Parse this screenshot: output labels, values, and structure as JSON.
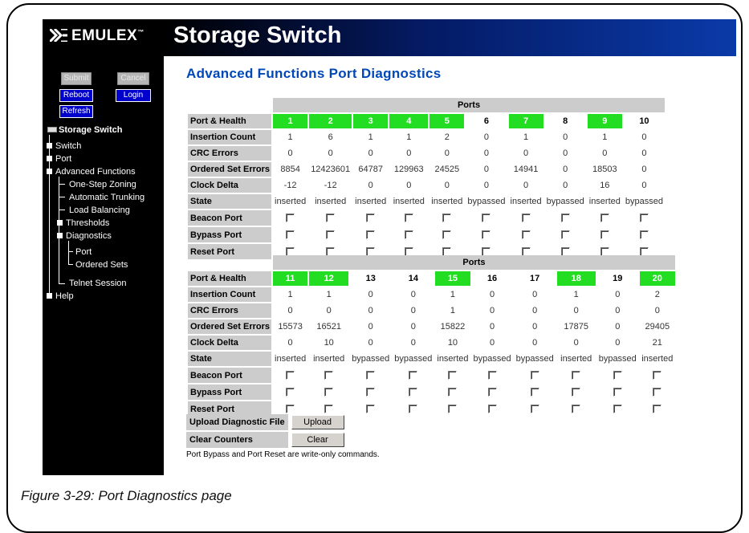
{
  "banner": {
    "logo": "EMULEX",
    "title": "Storage Switch"
  },
  "sidebar": {
    "buttons": {
      "submit": "Submit",
      "cancel": "Cancel",
      "reboot": "Reboot",
      "login": "Login",
      "refresh": "Refresh"
    },
    "tree": {
      "root": "Storage Switch",
      "switch": "Switch",
      "port": "Port",
      "advanced": "Advanced Functions",
      "onestep": "One-Step Zoning",
      "trunking": "Automatic Trunking",
      "loadbal": "Load Balancing",
      "thresholds": "Thresholds",
      "diagnostics": "Diagnostics",
      "diag_port": "Port",
      "diag_ordered": "Ordered Sets",
      "telnet": "Telnet Session",
      "help": "Help"
    }
  },
  "main": {
    "title": "Advanced Functions Port Diagnostics",
    "ports_header": "Ports",
    "row_labels": {
      "health": "Port & Health",
      "insertion": "Insertion Count",
      "crc": "CRC Errors",
      "ose": "Ordered Set Errors",
      "clock": "Clock Delta",
      "state": "State",
      "beacon": "Beacon Port",
      "bypass": "Bypass Port",
      "reset": "Reset Port"
    },
    "table1": {
      "ports": [
        "1",
        "2",
        "3",
        "4",
        "5",
        "6",
        "7",
        "8",
        "9",
        "10"
      ],
      "healthy": [
        true,
        true,
        true,
        true,
        true,
        false,
        true,
        false,
        true,
        false
      ],
      "insertion": [
        "1",
        "6",
        "1",
        "1",
        "2",
        "0",
        "1",
        "0",
        "1",
        "0"
      ],
      "crc": [
        "0",
        "0",
        "0",
        "0",
        "0",
        "0",
        "0",
        "0",
        "0",
        "0"
      ],
      "ose": [
        "8854",
        "12423601",
        "64787",
        "129963",
        "24525",
        "0",
        "14941",
        "0",
        "18503",
        "0"
      ],
      "clock": [
        "-12",
        "-12",
        "0",
        "0",
        "0",
        "0",
        "0",
        "0",
        "16",
        "0"
      ],
      "state": [
        "inserted",
        "inserted",
        "inserted",
        "inserted",
        "inserted",
        "bypassed",
        "inserted",
        "bypassed",
        "inserted",
        "bypassed"
      ]
    },
    "table2": {
      "ports": [
        "11",
        "12",
        "13",
        "14",
        "15",
        "16",
        "17",
        "18",
        "19",
        "20"
      ],
      "healthy": [
        true,
        true,
        false,
        false,
        true,
        false,
        false,
        true,
        false,
        true
      ],
      "insertion": [
        "1",
        "1",
        "0",
        "0",
        "1",
        "0",
        "0",
        "1",
        "0",
        "2"
      ],
      "crc": [
        "0",
        "0",
        "0",
        "0",
        "1",
        "0",
        "0",
        "0",
        "0",
        "0"
      ],
      "ose": [
        "15573",
        "16521",
        "0",
        "0",
        "15822",
        "0",
        "0",
        "17875",
        "0",
        "29405"
      ],
      "clock": [
        "0",
        "10",
        "0",
        "0",
        "10",
        "0",
        "0",
        "0",
        "0",
        "21"
      ],
      "state": [
        "inserted",
        "inserted",
        "bypassed",
        "bypassed",
        "inserted",
        "bypassed",
        "bypassed",
        "inserted",
        "bypassed",
        "inserted"
      ]
    },
    "actions": {
      "upload_label": "Upload Diagnostic File",
      "upload_button": "Upload",
      "clear_label": "Clear Counters",
      "clear_button": "Clear"
    },
    "note": "Port Bypass and Port Reset are write-only commands."
  },
  "caption": "Figure 3-29: Port Diagnostics page",
  "colors": {
    "healthy": "#22dd22",
    "banner": "#0a3aa8",
    "title": "#0048b8",
    "label_bg": "#cccccc"
  }
}
